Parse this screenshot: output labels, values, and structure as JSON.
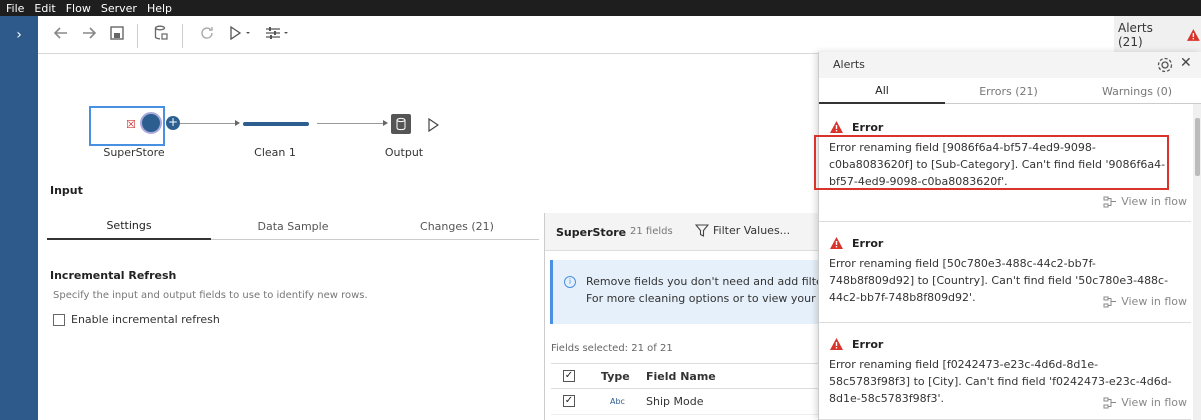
{
  "menu": [
    "File",
    "Edit",
    "Flow",
    "Server",
    "Help"
  ],
  "toolbar": {
    "alerts_label": "Alerts (21)"
  },
  "flow": {
    "nodes": [
      {
        "label": "SuperStore"
      },
      {
        "label": "Clean 1"
      },
      {
        "label": "Output"
      }
    ]
  },
  "panel": {
    "title": "Input",
    "tabs": [
      "Settings",
      "Data Sample",
      "Changes (21)"
    ],
    "incremental_title": "Incremental Refresh",
    "incremental_desc": "Specify the input and output fields to use to identify new rows.",
    "incremental_checkbox": "Enable incremental refresh"
  },
  "fields_panel": {
    "source": "SuperStore",
    "count": "21 fields",
    "filter": "Filter Values...",
    "info_line1": "Remove fields you don't need and add filters t",
    "info_line2": "For more cleaning options or to view your dat",
    "selected": "Fields selected: 21 of 21",
    "columns": {
      "type": "Type",
      "name": "Field Name"
    },
    "rows": [
      {
        "type": "Abc",
        "name": "Ship Mode"
      }
    ]
  },
  "alerts": {
    "title": "Alerts",
    "tabs": [
      "All",
      "Errors (21)",
      "Warnings (0)"
    ],
    "items": [
      {
        "level": "Error",
        "message": "Error renaming field [9086f6a4-bf57-4ed9-9098-c0ba8083620f] to [Sub-Category]. Can't find field '9086f6a4-bf57-4ed9-9098-c0ba8083620f'.",
        "action": "View in flow"
      },
      {
        "level": "Error",
        "message": "Error renaming field [50c780e3-488c-44c2-bb7f-748b8f809d92] to [Country]. Can't find field '50c780e3-488c-44c2-bb7f-748b8f809d92'.",
        "action": "View in flow"
      },
      {
        "level": "Error",
        "message": "Error renaming field [f0242473-e23c-4d6d-8d1e-58c5783f98f3] to [City]. Can't find field 'f0242473-e23c-4d6d-8d1e-58c5783f98f3'.",
        "action": "View in flow"
      }
    ]
  },
  "colors": {
    "rail": "#2d5a8a",
    "accent": "#2c5e8f",
    "error": "#d9342b"
  }
}
